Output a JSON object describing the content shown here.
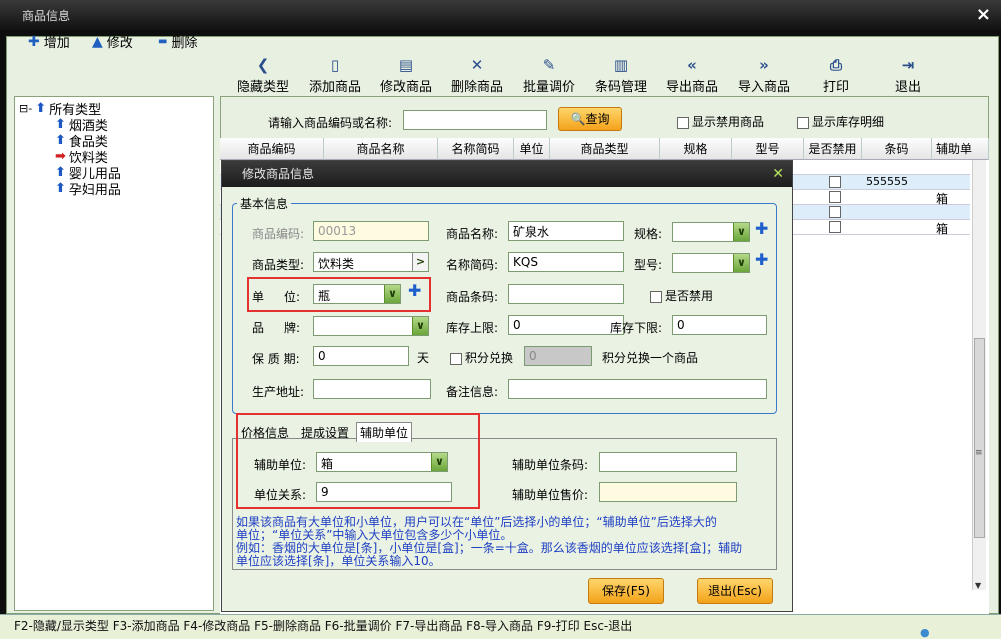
{
  "window": {
    "title": "商品信息",
    "close_icon": "×"
  },
  "toolbar_small": [
    {
      "icon": "plus-icon",
      "glyph": "✚",
      "label": "增加"
    },
    {
      "icon": "up-arrow-icon",
      "glyph": "▲",
      "label": "修改"
    },
    {
      "icon": "minus-icon",
      "glyph": "▬",
      "label": "删除"
    }
  ],
  "toolbar": [
    {
      "icon": "chevron-left-icon",
      "glyph": "❮",
      "label": "隐藏类型"
    },
    {
      "icon": "document-icon",
      "glyph": "▯",
      "label": "添加商品"
    },
    {
      "icon": "edit-doc-icon",
      "glyph": "▤",
      "label": "修改商品"
    },
    {
      "icon": "x-icon",
      "glyph": "✕",
      "label": "删除商品"
    },
    {
      "icon": "pen-icon",
      "glyph": "✎",
      "label": "批量调价"
    },
    {
      "icon": "barcode-icon",
      "glyph": "▥",
      "label": "条码管理"
    },
    {
      "icon": "double-left-icon",
      "glyph": "«",
      "label": "导出商品"
    },
    {
      "icon": "double-right-icon",
      "glyph": "»",
      "label": "导入商品"
    },
    {
      "icon": "printer-icon",
      "glyph": "⎙",
      "label": "打印"
    },
    {
      "icon": "exit-icon",
      "glyph": "⇥",
      "label": "退出"
    }
  ],
  "tree": {
    "root": "所有类型",
    "root_prefix": "⊟-",
    "items": [
      "烟酒类",
      "食品类",
      "饮料类",
      "婴儿用品",
      "孕妇用品"
    ],
    "selected": "饮料类"
  },
  "search": {
    "label": "请输入商品编码或名称:",
    "value": "",
    "button": "查询",
    "show_disabled": "显示禁用商品",
    "show_stock": "显示库存明细"
  },
  "grid": {
    "headers": [
      "商品编码",
      "商品名称",
      "名称简码",
      "单位",
      "商品类型",
      "规格",
      "型号",
      "是否禁用",
      "条码",
      "辅助单"
    ],
    "visible_cells": [
      {
        "col": "条码",
        "value": "555555"
      },
      {
        "col": "辅助单",
        "value": "箱"
      },
      {
        "col": "辅助单",
        "value": "箱"
      }
    ]
  },
  "dialog": {
    "title": "修改商品信息",
    "close": "✕",
    "basic_legend": "基本信息",
    "code_label": "商品编码:",
    "code_value": "00013",
    "name_label": "商品名称:",
    "name_value": "矿泉水",
    "spec_label": "规格:",
    "type_label": "商品类型:",
    "type_value": "饮料类",
    "abbr_label": "名称简码:",
    "abbr_value": "KQS",
    "model_label": "型号:",
    "unit_label_1": "单",
    "unit_label_2": "位:",
    "unit_value": "瓶",
    "barcode_label": "商品条码:",
    "barcode_value": "",
    "disabled_label": "是否禁用",
    "brand_label_1": "品",
    "brand_label_2": "牌:",
    "stock_max_label": "库存上限:",
    "stock_max_value": "0",
    "stock_min_label": "库存下限:",
    "stock_min_value": "0",
    "shelf_label": "保 质 期:",
    "shelf_value": "0",
    "shelf_unit": "天",
    "points_label": "积分兑换",
    "points_value": "0",
    "points_text": "积分兑换一个商品",
    "origin_label": "生产地址:",
    "origin_value": "",
    "remark_label": "备注信息:",
    "remark_value": "",
    "tabs": [
      "价格信息",
      "提成设置",
      "辅助单位"
    ],
    "active_tab": "辅助单位",
    "aux_unit_label": "辅助单位:",
    "aux_unit_value": "箱",
    "aux_barcode_label": "辅助单位条码:",
    "aux_barcode_value": "",
    "relation_label": "单位关系:",
    "relation_value": "9",
    "aux_price_label": "辅助单位售价:",
    "aux_price_value": "",
    "note_lines": [
      "如果该商品有大单位和小单位，用户可以在“单位”后选择小的单位；“辅助单位”后选择大的",
      "单位；“单位关系”中输入大单位包含多少个小单位。",
      "例如：香烟的大单位是[条]，小单位是[盒]；一条=十盒。那么该香烟的单位应该选择[盒]；辅助",
      "单位应该选择[条]，单位关系输入10。"
    ],
    "save": "保存(F5)",
    "exit": "退出(Esc)"
  },
  "statusbar": "F2-隐藏/显示类型  F3-添加商品  F4-修改商品  F5-删除商品  F6-批量调价  F7-导出商品  F8-导入商品  F9-打印  Esc-退出",
  "colors": {
    "accent": "#1e5fcc",
    "highlight": "#e53030",
    "button": "#f3a21a"
  }
}
